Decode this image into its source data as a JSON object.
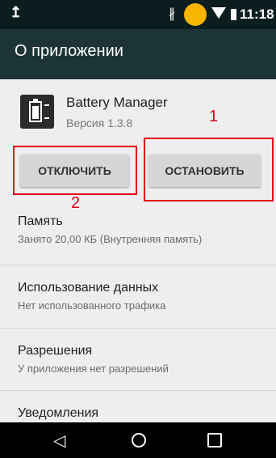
{
  "status_bar": {
    "time": "11:18",
    "upload_glyph": "↥",
    "bluetooth_glyph": "∦"
  },
  "app_bar": {
    "title": "О приложении"
  },
  "app": {
    "name": "Battery Manager",
    "version": "Версия 1.3.8"
  },
  "buttons": {
    "disable_label": "ОТКЛЮЧИТЬ",
    "stop_label": "ОСТАНОВИТЬ"
  },
  "annotations": {
    "stop_number": "1",
    "disable_number": "2",
    "color": "#e3001b"
  },
  "settings": [
    {
      "title": "Память",
      "subtitle": "Занято 20,00 КБ (Внутренняя память)"
    },
    {
      "title": "Использование данных",
      "subtitle": "Нет использованного трафика"
    },
    {
      "title": "Разрешения",
      "subtitle": "У приложения нет разрешений"
    },
    {
      "title": "Уведомления",
      "subtitle": ""
    }
  ],
  "navigation": {
    "back_glyph": "◁",
    "icons": [
      "back-icon",
      "home-icon",
      "recents-icon"
    ]
  },
  "icons": [
    "upload-icon",
    "bluetooth-icon",
    "notification-dot",
    "wifi-icon",
    "battery-icon",
    "app-battery-icon"
  ]
}
